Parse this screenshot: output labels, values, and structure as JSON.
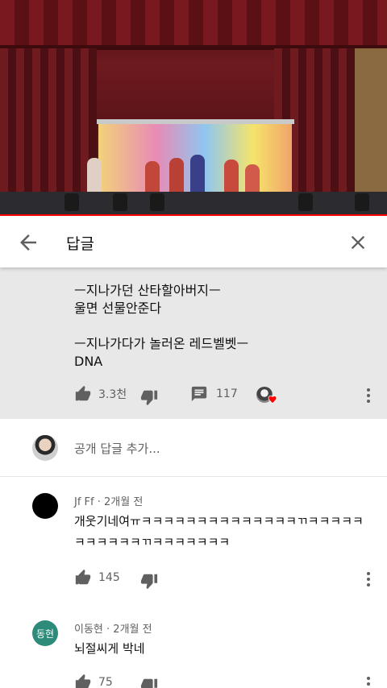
{
  "header": {
    "title": "답글"
  },
  "parent_comment": {
    "lines": "ㅡ지나가던 산타할아버지ㅡ\n울면 선물안준다\n\nㅡ지나가다가 놀러온 레드벨벳ㅡ\nDNA",
    "likes": "3.3천",
    "replies": "117"
  },
  "add_reply": {
    "placeholder": "공개 답글 추가..."
  },
  "replies": [
    {
      "author": "Jf Ff",
      "time": "2개월 전",
      "text": "개웃기네여ㅠㅋㅋㅋㅋㅋㅋㅋㅋㅋㅋㅋㅋㅋㅋㄲㅋㅋㅋㅋㅋㅋㅋㅋㅋㅋㅋㄲㅋㅋㅋㅋㅋㅋㅋ",
      "likes": "145"
    },
    {
      "author": "이동현",
      "avatar_text": "동현",
      "time": "2개월 전",
      "text": "뇌절씨게 박네",
      "likes": "75"
    }
  ],
  "colors": {
    "accent": "#ff0000",
    "avatar_green": "#2e8b7a",
    "highlight_bg": "#e8e8e8"
  },
  "icons": [
    "back-arrow-icon",
    "close-icon",
    "thumb-up-icon",
    "thumb-down-icon",
    "reply-icon",
    "more-vert-icon",
    "heart-icon"
  ]
}
